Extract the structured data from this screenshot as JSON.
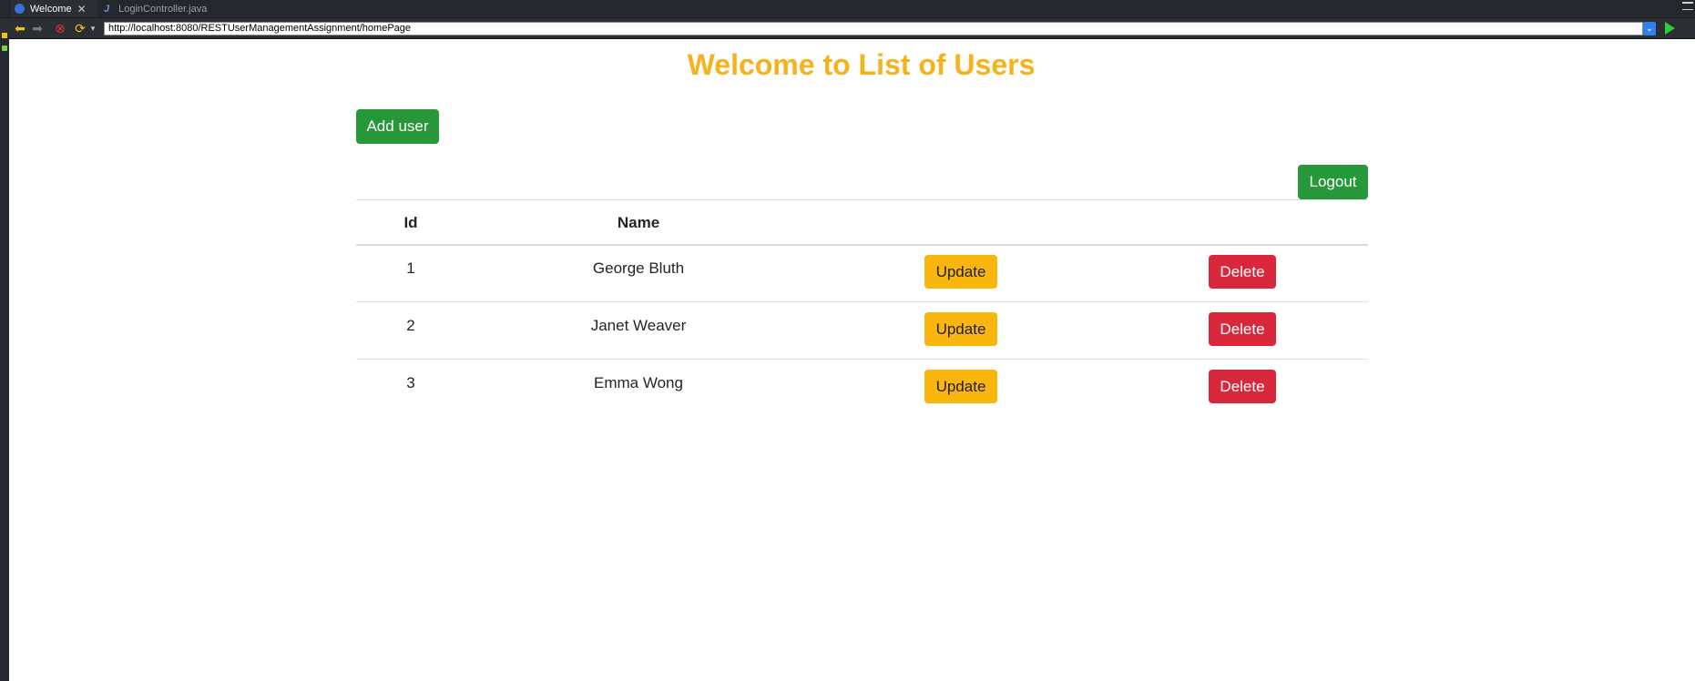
{
  "ide": {
    "tabs": [
      {
        "label": "Welcome",
        "active": true
      },
      {
        "label": "LoginController.java",
        "active": false
      }
    ],
    "url": "http://localhost:8080/RESTUserManagementAssignment/homePage"
  },
  "page": {
    "title": "Welcome to List of Users",
    "add_button": "Add user",
    "logout_button": "Logout",
    "columns": [
      "Id",
      "Name"
    ],
    "rows": [
      {
        "id": "1",
        "name": "George Bluth",
        "update": "Update",
        "delete": "Delete"
      },
      {
        "id": "2",
        "name": "Janet Weaver",
        "update": "Update",
        "delete": "Delete"
      },
      {
        "id": "3",
        "name": "Emma Wong",
        "update": "Update",
        "delete": "Delete"
      }
    ]
  },
  "colors": {
    "title": "#f6b21b",
    "success": "#27983a",
    "warning": "#f8b60e",
    "danger": "#d9283c"
  }
}
